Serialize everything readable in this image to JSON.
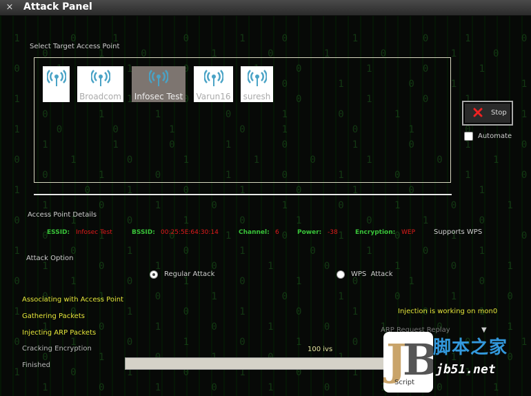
{
  "window": {
    "title": "Attack Panel",
    "close_glyph": "×"
  },
  "target_section": {
    "label": "Select Target Access Point"
  },
  "access_points": [
    {
      "name": "",
      "selected": false,
      "icon": "wifi-signal-icon"
    },
    {
      "name": "Broadcom",
      "selected": false,
      "icon": "wifi-signal-icon"
    },
    {
      "name": "Infosec Test",
      "selected": true,
      "icon": "wifi-signal-icon"
    },
    {
      "name": "Varun16",
      "selected": false,
      "icon": "wifi-signal-icon"
    },
    {
      "name": "suresh",
      "selected": false,
      "icon": "wifi-signal-icon"
    }
  ],
  "controls": {
    "stop_label": "Stop",
    "automate_label": "Automate",
    "automate_checked": false
  },
  "details": {
    "label": "Access Point Details",
    "essid_label": "ESSID:",
    "essid": "Infosec Test",
    "bssid_label": "BSSID:",
    "bssid": "00:25:5E:64:30:14",
    "channel_label": "Channel:",
    "channel": "6",
    "power_label": "Power:",
    "power": "-38",
    "encryption_label": "Encryption:",
    "encryption": "WEP",
    "wps": "Supports WPS"
  },
  "attack_option": {
    "label": "Attack Option",
    "regular": "Regular Attack",
    "wps": "WPS  Attack",
    "selected": "regular"
  },
  "status": {
    "steps": [
      "Associating with Access Point",
      "Gathering Packets",
      "Injecting ARP Packets",
      "Cracking Encryption",
      "Finished"
    ],
    "injection": "Injection is working on mon0",
    "method": "ARP Request Replay",
    "ivs": "100 ivs",
    "progress": 0
  },
  "watermark": {
    "logo": "jB",
    "script": "Script",
    "cn": "脚本之家",
    "url": "jb51.net"
  },
  "colors": {
    "accent_green": "#39c439",
    "value_red": "#e21b1b",
    "status_yellow": "#e6e63a",
    "wifi_blue": "#4aa3c6"
  }
}
